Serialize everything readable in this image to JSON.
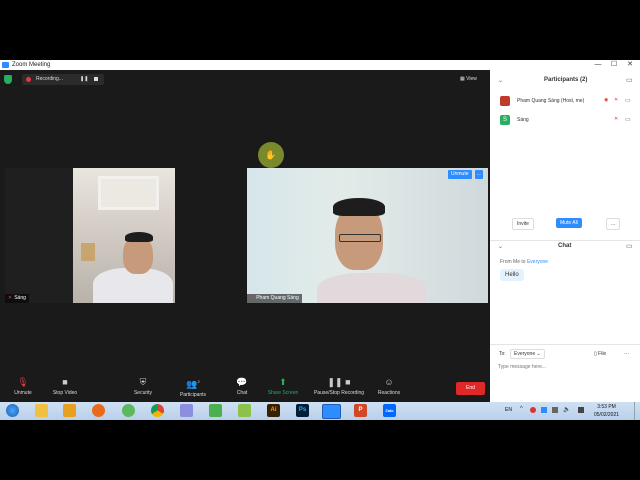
{
  "window": {
    "title": "Zoom Meeting",
    "min": "—",
    "max": "☐",
    "close": "✕"
  },
  "recording": {
    "label": "Recording...",
    "pause": "❚❚"
  },
  "view": {
    "label": "View",
    "icon": "grid-icon"
  },
  "tiles": [
    {
      "name": "Sáng"
    },
    {
      "name": "Pham Quang Sáng",
      "unmute": "Unmute",
      "more": "..."
    }
  ],
  "toolbar": {
    "items": [
      {
        "label": "Unmute",
        "icon": "mic-off-icon"
      },
      {
        "label": "Stop Video",
        "icon": "camera-icon"
      },
      {
        "label": "Security",
        "icon": "shield-icon"
      },
      {
        "label": "Participants",
        "icon": "people-icon",
        "count": "2"
      },
      {
        "label": "Chat",
        "icon": "chat-icon"
      },
      {
        "label": "Share Screen",
        "icon": "share-icon"
      },
      {
        "label": "Pause/Stop Recording",
        "icon": "record-icon"
      },
      {
        "label": "Reactions",
        "icon": "emoji-icon"
      }
    ],
    "end": "End",
    "colors": {
      "share": "#27ae60",
      "end": "#e02828"
    }
  },
  "participants": {
    "title": "Participants (2)",
    "list": [
      {
        "name": "Pham Quang Sáng (Host, me)",
        "avatar_color": "#c0392b"
      },
      {
        "name": "Sáng",
        "avatar_letter": "S",
        "avatar_color": "#27ae60"
      }
    ],
    "invite": "Invite",
    "mute_all": "Mute All",
    "more": "..."
  },
  "chat": {
    "title": "Chat",
    "from": "From Me to",
    "to_target": "Everyone",
    "message": "Hello",
    "to_label": "To:",
    "to_value": "Everyone",
    "file": "File",
    "more": "...",
    "placeholder": "Type message here..."
  },
  "taskbar": {
    "lang": "EN",
    "time": "3:53 PM",
    "date": "05/02/2021",
    "apps": [
      "start-icon",
      "explorer-icon",
      "media-icon",
      "firefox-icon",
      "coccoc-icon",
      "chrome-icon",
      "paint-icon",
      "network-icon",
      "pen-icon",
      "illustrator-icon",
      "photoshop-icon",
      "zoom-icon",
      "powerpoint-icon",
      "zalo-icon"
    ],
    "app_labels": {
      "illustrator": "Ai",
      "photoshop": "Ps",
      "powerpoint": "P",
      "zalo": "Zalo"
    }
  },
  "accent": "#2d8cff"
}
